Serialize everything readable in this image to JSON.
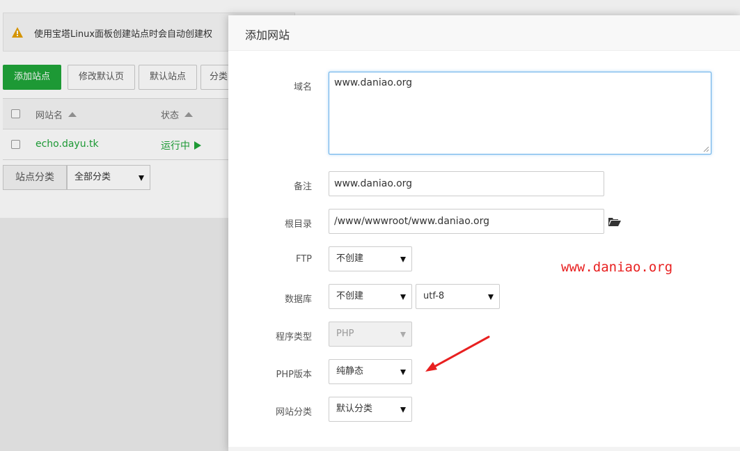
{
  "background": {
    "alert": {
      "text": "使用宝塔Linux面板创建站点时会自动创建权",
      "icon": "warning-icon"
    },
    "toolbar": {
      "add_site": "添加站点",
      "edit_default_page": "修改默认页",
      "default_site": "默认站点",
      "category": "分类"
    },
    "table": {
      "col_site_name": "网站名",
      "col_status": "状态",
      "rows": [
        {
          "site": "echo.dayu.tk",
          "status": "运行中"
        }
      ]
    },
    "category_filter": {
      "label": "站点分类",
      "value": "全部分类"
    }
  },
  "modal": {
    "title": "添加网站",
    "fields": {
      "domain": {
        "label": "域名",
        "value": "www.daniao.org"
      },
      "remark": {
        "label": "备注",
        "value": "www.daniao.org"
      },
      "root_dir": {
        "label": "根目录",
        "value": "/www/wwwroot/www.daniao.org"
      },
      "ftp": {
        "label": "FTP",
        "value": "不创建"
      },
      "database": {
        "label": "数据库",
        "value": "不创建",
        "charset": "utf-8"
      },
      "program_type": {
        "label": "程序类型",
        "value": "PHP"
      },
      "php_version": {
        "label": "PHP版本",
        "value": "纯静态"
      },
      "site_category": {
        "label": "网站分类",
        "value": "默认分类"
      }
    }
  },
  "watermark": "www.daniao.org",
  "colors": {
    "accent_green": "#20a53a",
    "focus_blue": "#66afe9",
    "annotation_red": "#e82020",
    "warning_orange": "#e5a000"
  }
}
